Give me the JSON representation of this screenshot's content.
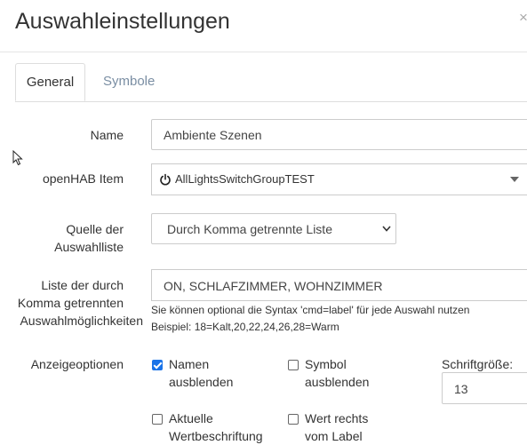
{
  "dialog": {
    "title": "Auswahleinstellungen",
    "close_glyph": "×"
  },
  "tabs": [
    {
      "label": "General"
    },
    {
      "label": "Symbole"
    }
  ],
  "form": {
    "name": {
      "label": "Name",
      "value": "Ambiente Szenen"
    },
    "item": {
      "label": "openHAB Item",
      "icon": "power-icon",
      "value": "AllLightsSwitchGroupTEST"
    },
    "source": {
      "label_line1": "Quelle der",
      "label_line2": "Auswahlliste",
      "value": "Durch Komma getrennte Liste"
    },
    "options_list": {
      "label_line1": "Liste der durch",
      "label_line2": "Komma getrennten",
      "label_line3": "Auswahlmöglichkeiten",
      "value": "ON, SCHLAFZIMMER, WOHNZIMMER",
      "help1": "Sie können optional die Syntax 'cmd=label' für jede Auswahl nutzen",
      "help2": "Beispiel: 18=Kalt,20,22,24,26,28=Warm"
    },
    "display": {
      "label": "Anzeigeoptionen",
      "hide_names": {
        "line1": "Namen",
        "line2": "ausblenden",
        "checked": true
      },
      "hide_symbol": {
        "line1": "Symbol",
        "line2": "ausblenden",
        "checked": false
      },
      "current_label": {
        "line1": "Aktuelle",
        "line2": "Wertbeschriftung",
        "checked": false
      },
      "value_right": {
        "line1": "Wert rechts",
        "line2": "vom Label",
        "checked": false
      },
      "font_size": {
        "label": "Schriftgröße:",
        "value": "13"
      }
    }
  },
  "colors": {
    "checkbox_checked": "#1a73e8",
    "tab_inactive": "#7a8ea3"
  }
}
